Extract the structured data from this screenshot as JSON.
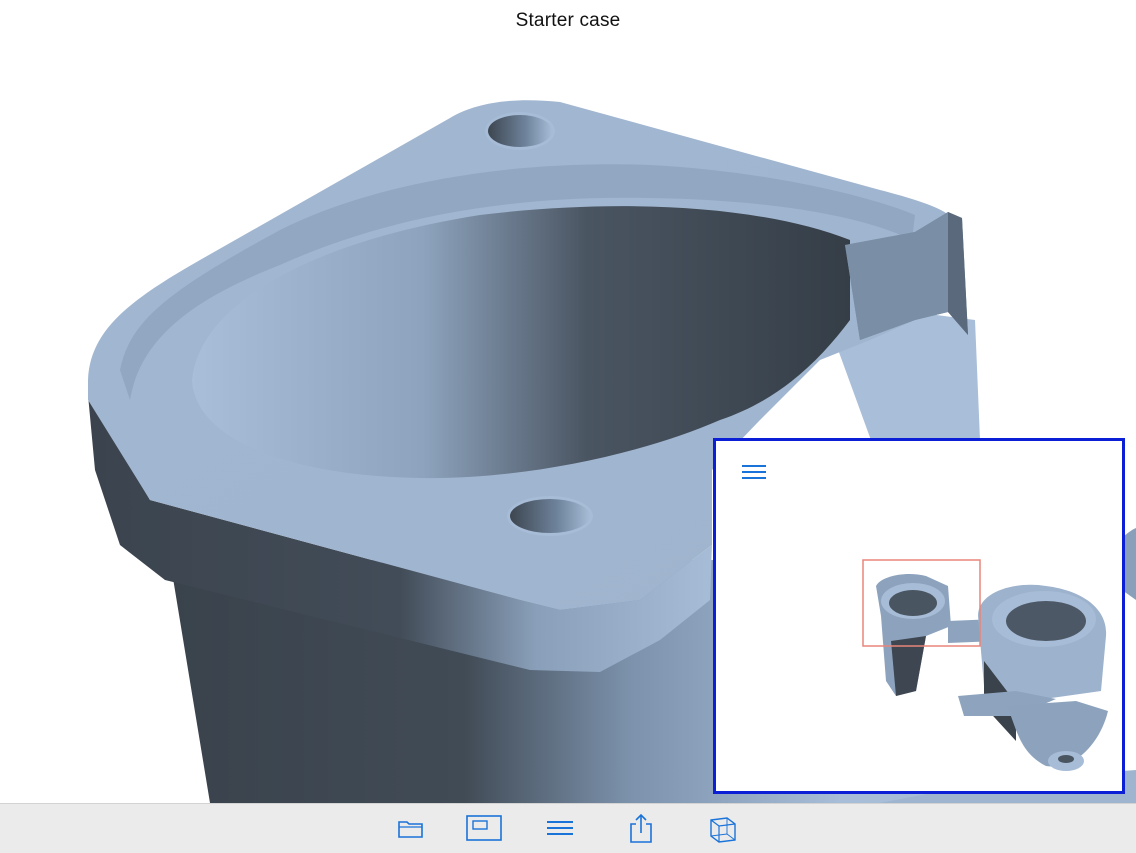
{
  "header": {
    "title": "Starter case"
  },
  "colors": {
    "accent": "#1a73d9",
    "minimap_border": "#0a1fd6",
    "view_box": "#e8857a",
    "model": "#a7bcd6"
  },
  "toolbar": {
    "items": [
      {
        "icon": "folder-icon"
      },
      {
        "icon": "display-icon"
      },
      {
        "icon": "menu-icon"
      },
      {
        "icon": "share-icon"
      },
      {
        "icon": "cube-icon"
      }
    ]
  },
  "minimap": {
    "menu_icon": "menu-icon"
  }
}
